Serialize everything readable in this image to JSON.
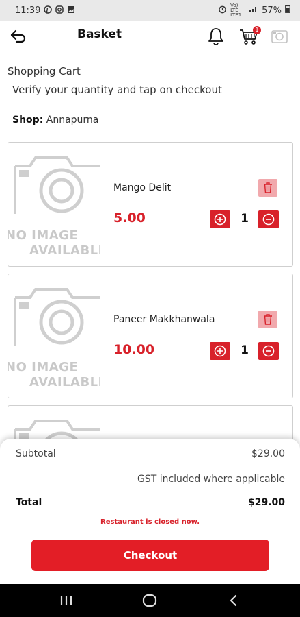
{
  "status_bar": {
    "time": "11:39",
    "left_icons": [
      "pinterest-icon",
      "instagram-icon",
      "gallery-icon"
    ],
    "network": "Vo) LTE LTE1",
    "signal": "ᵢₗₗ",
    "battery": "57%"
  },
  "header": {
    "title": "Basket",
    "cart_badge": "1"
  },
  "cart": {
    "heading": "Shopping Cart",
    "subheading": "Verify your quantity and tap on checkout",
    "shop_label": "Shop:",
    "shop_name": "Annapurna"
  },
  "placeholder": {
    "line1": "NO IMAGE",
    "line2": "AVAILABLE"
  },
  "items": [
    {
      "name": "Mango Delit",
      "price": "5.00",
      "quantity": "1"
    },
    {
      "name": "Paneer Makkhanwala",
      "price": "10.00",
      "quantity": "1"
    }
  ],
  "summary": {
    "subtotal_label": "Subtotal",
    "subtotal_value": "$29.00",
    "gst_note": "GST included where applicable",
    "total_label": "Total",
    "total_value": "$29.00",
    "closed_note": "Restaurant is closed now.",
    "checkout_label": "Checkout"
  },
  "colors": {
    "accent": "#d8212a",
    "checkout": "#e31e26",
    "delete_bg": "#f1a9ad"
  },
  "icons": {
    "back": "back-arrow-icon",
    "bell": "bell-icon",
    "cart": "cart-icon",
    "camera": "camera-icon",
    "delete": "trash-icon",
    "plus": "plus-circle-icon",
    "minus": "minus-circle-icon"
  }
}
